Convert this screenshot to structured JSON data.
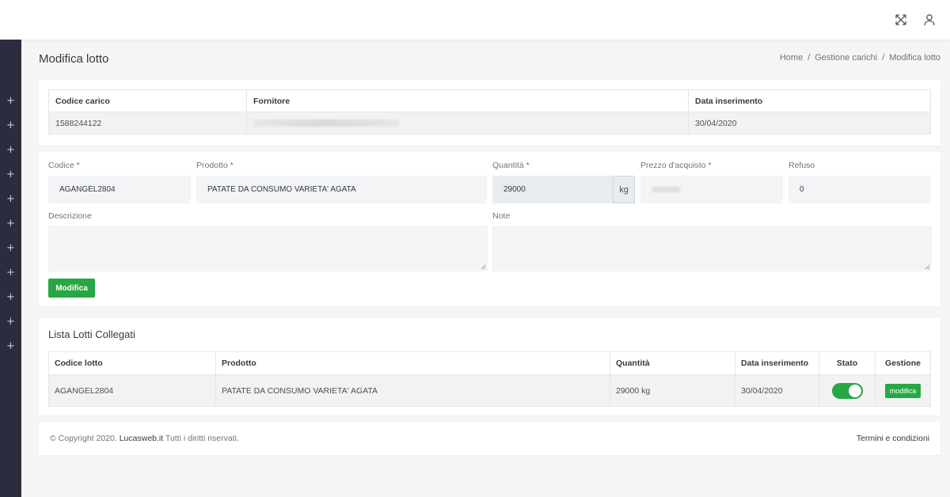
{
  "header": {
    "fullscreen_icon": "fullscreen-icon",
    "user_icon": "user-icon"
  },
  "sidebar": {
    "items": [
      "+",
      "+",
      "+",
      "+",
      "+",
      "+",
      "+",
      "+",
      "+",
      "+",
      "+"
    ]
  },
  "page": {
    "title": "Modifica lotto",
    "breadcrumb": [
      "Home",
      "Gestione carichi",
      "Modifica lotto"
    ],
    "breadcrumb_sep": "/"
  },
  "carico": {
    "headers": [
      "Codice carico",
      "Fornitore",
      "Data inserimento"
    ],
    "row": {
      "codice": "1588244122",
      "fornitore": "",
      "data": "30/04/2020"
    }
  },
  "form": {
    "codice": {
      "label": "Codice *",
      "value": "AGANGEL2804"
    },
    "prodotto": {
      "label": "Prodotto *",
      "value": "PATATE DA CONSUMO VARIETA' AGATA"
    },
    "quantita": {
      "label": "Quantità *",
      "value": "29000",
      "unit": "kg"
    },
    "prezzo": {
      "label": "Prezzo d'acquisto *",
      "value": ""
    },
    "refuso": {
      "label": "Refuso",
      "value": "0"
    },
    "descrizione": {
      "label": "Descrizione",
      "value": ""
    },
    "note": {
      "label": "Note",
      "value": ""
    },
    "submit_label": "Modifica"
  },
  "lotti": {
    "title": "Lista Lotti Collegati",
    "headers": [
      "Codice lotto",
      "Prodotto",
      "Quantità",
      "Data inserimento",
      "Stato",
      "Gestione"
    ],
    "rows": [
      {
        "codice": "AGANGEL2804",
        "prodotto": "PATATE DA CONSUMO VARIETA' AGATA",
        "quantita": "29000 kg",
        "data": "30/04/2020",
        "stato": true,
        "action": "modifica"
      }
    ]
  },
  "footer": {
    "copyright": "© Copyright 2020.",
    "brand": "Lucasweb.it",
    "rights": "Tutti i diritti riservati.",
    "terms": "Termini e condizioni"
  },
  "colors": {
    "primary_green": "#28a745",
    "sidebar_bg": "#2b2d3e"
  }
}
